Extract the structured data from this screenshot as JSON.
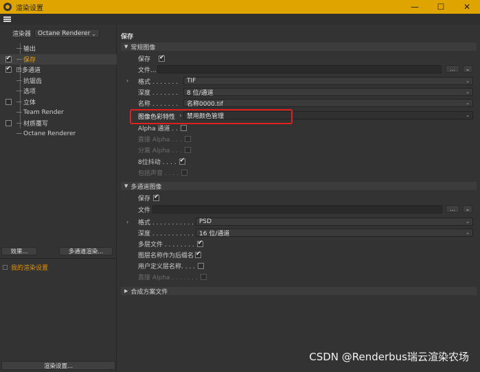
{
  "window": {
    "title": "渲染设置",
    "minimize": "—",
    "maximize": "☐",
    "close": "✕"
  },
  "left": {
    "renderer_label": "渲染器",
    "renderer_value": "Octane Renderer",
    "tree": [
      {
        "label": "输出",
        "checkbox": "none"
      },
      {
        "label": "保存",
        "checkbox": "checked",
        "selected": true
      },
      {
        "label": "多通道",
        "checkbox": "checked",
        "expandable": true
      },
      {
        "label": "抗锯齿",
        "checkbox": "none"
      },
      {
        "label": "选项",
        "checkbox": "none"
      },
      {
        "label": "立体",
        "checkbox": "unchecked"
      },
      {
        "label": "Team Render",
        "checkbox": "none"
      },
      {
        "label": "材质覆写",
        "checkbox": "unchecked"
      },
      {
        "label": "Octane Renderer",
        "checkbox": "none"
      }
    ],
    "effects_button": "效果...",
    "multipass_button": "多通道渲染...",
    "my_settings": "我的渲染设置",
    "render_settings_button": "渲染设置..."
  },
  "right": {
    "section_title": "保存",
    "regular": {
      "header": "常规图像",
      "save_label": "保存",
      "file_label": "文件...",
      "format_label": "格式 . . . . . . .",
      "format_value": "TIF",
      "depth_label": "深度 . . . . . . .",
      "depth_value": "8 位/通道",
      "name_label": "名称 . . . . . . .",
      "name_value": "名称0000.tif",
      "color_profile_label": "图像色彩特性",
      "color_profile_value": "禁用颜色管理",
      "alpha_label": "Alpha 通道 . .",
      "straight_alpha_label": "直接 Alpha . . .",
      "separate_alpha_label": "分离 Alpha . . .",
      "dither_label": "8位抖动 . . . .",
      "include_sound_label": "包括声音 . . . .",
      "dots_button": "..."
    },
    "multipass": {
      "header": "多通道图像",
      "save_label": "保存",
      "file_label": "文件",
      "format_label": "格式 . . . . . . . . . . .",
      "format_value": "PSD",
      "depth_label": "深度 . . . . . . . . . . .",
      "depth_value": "16 位/通道",
      "layered_label": "多层文件 . . . . . . . .",
      "layer_name_suffix_label": "图层名称作为后缀名",
      "user_layer_names_label": "用户定义层名称. . . .",
      "straight_alpha_label": "直接 Alpha . . . . . . .",
      "dots_button": "..."
    },
    "compositing": {
      "header": "合成方案文件"
    }
  },
  "watermark": "CSDN @Renderbus瑞云渲染农场",
  "colors": {
    "titlebar": "#e0a400",
    "selected_text": "#f0a000",
    "highlight_border": "#e0201b"
  }
}
